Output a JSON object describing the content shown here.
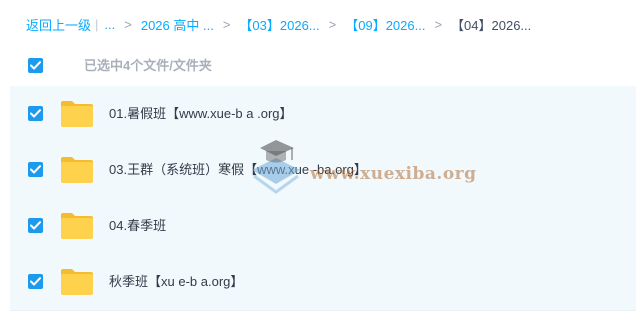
{
  "breadcrumb": {
    "back_label": "返回上一级",
    "ellipsis": "...",
    "items": [
      "2026 高中 ...",
      "【03】2026...",
      "【09】2026..."
    ],
    "current": "【04】2026..."
  },
  "selection": {
    "checked": true,
    "label": "已选中4个文件/文件夹"
  },
  "files": [
    {
      "name": "01.暑假班【www.xue-b a .org】",
      "checked": true,
      "icon": "folder-icon"
    },
    {
      "name": "03.王群（系统班）寒假【www.xue -ba.org】",
      "checked": true,
      "icon": "folder-icon"
    },
    {
      "name": "04.春季班",
      "checked": true,
      "icon": "folder-icon"
    },
    {
      "name": "秋季班【xu e-b a.org】",
      "checked": true,
      "icon": "folder-icon"
    }
  ],
  "watermark": {
    "text": "www.xuexiba.org"
  },
  "colors": {
    "accent": "#09aaff",
    "checkbox": "#1b9aee",
    "folder": "#ffd24d",
    "row_bg": "#f2f9fd"
  }
}
